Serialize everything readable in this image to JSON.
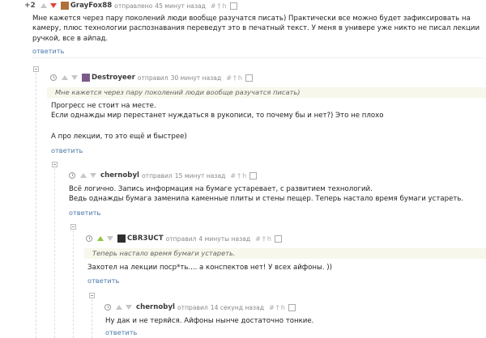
{
  "comments": [
    {
      "score": "+2",
      "author": "GrayFox88",
      "action": "отправлено",
      "time": "45 минут назад",
      "text_lines": [
        "Мне кажется через пару поколений люди вообще разучатся писать) Практически все можно будет зафиксировать на",
        "камеру, плюс технологии распознавания переведут это в печатный текст. У меня в универе уже никто не писал лекции",
        "ручкой, все в айпад."
      ],
      "reply_label": "ответить"
    },
    {
      "author": "Destroyeer",
      "action": "отправил",
      "time": "30 минут назад",
      "quote": "Мне кажется через пару поколений люди вообще разучатся писать)",
      "text_lines": [
        "Прогресс не стоит на месте.",
        "Если однажды мир перестанет нуждаться в рукописи, то почему бы и нет?) Это не плохо",
        "",
        "А про лекции, то это ещё и быстрее)"
      ],
      "reply_label": "ответить"
    },
    {
      "author": "chernobyl",
      "action": "отправил",
      "time": "15 минут назад",
      "text_lines": [
        "Всё логично. Запись информация на бумаге устаревает, с развитием технологий.",
        "Ведь однажды бумага заменила каменные плиты и стены пещер. Теперь настало время бумаги устареть."
      ],
      "reply_label": "ответить"
    },
    {
      "author": "CBR3UCT",
      "action": "отправил",
      "time": "4 минуты назад",
      "quote": "Теперь настало время бумаги устареть.",
      "text_lines": [
        "Захотел на лекции поср*ть.... а конспектов нет! У всех айфоны. ))"
      ],
      "reply_label": "ответить"
    },
    {
      "author": "chernobyl",
      "action": "отправил",
      "time": "14 секунд назад",
      "text_lines": [
        "Ну дак и не теряйся. Айфоны нынче достаточно тонкие."
      ],
      "reply_label": "ответить"
    }
  ],
  "tool_glyphs": {
    "hash": "#",
    "dagger": "†",
    "h": "h"
  },
  "colors": {
    "upvote": "#8dc63f",
    "downvote": "#e0443b",
    "reply_link": "#4a78a8",
    "quote_bg": "#f7f7ec"
  }
}
